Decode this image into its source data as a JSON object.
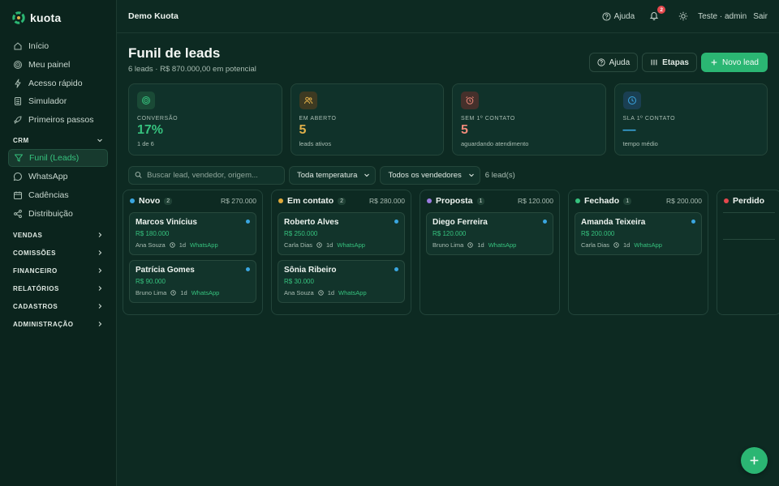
{
  "brand": {
    "name": "kuota"
  },
  "sidebar": {
    "top_items": [
      {
        "label": "Início",
        "icon": "home-icon"
      },
      {
        "label": "Meu painel",
        "icon": "target-icon"
      },
      {
        "label": "Acesso rápido",
        "icon": "bolt-icon"
      },
      {
        "label": "Simulador",
        "icon": "calculator-icon"
      },
      {
        "label": "Primeiros passos",
        "icon": "rocket-icon"
      }
    ],
    "crm_section": "CRM",
    "crm_items": [
      {
        "label": "Funil (Leads)",
        "icon": "funnel-icon",
        "active": true
      },
      {
        "label": "WhatsApp",
        "icon": "chat-icon"
      },
      {
        "label": "Cadências",
        "icon": "calendar-icon"
      },
      {
        "label": "Distribuição",
        "icon": "share-icon"
      }
    ],
    "sections": [
      "VENDAS",
      "COMISSÕES",
      "FINANCEIRO",
      "RELATÓRIOS",
      "CADASTROS",
      "ADMINISTRAÇÃO"
    ]
  },
  "topbar": {
    "company": "Demo Kuota",
    "help": "Ajuda",
    "notifications": "2",
    "user": "Teste · admin",
    "logout": "Sair"
  },
  "page": {
    "title": "Funil de leads",
    "subtitle": "6 leads · R$ 870.000,00 em potencial",
    "help_button": "Ajuda",
    "stages_button": "Etapas",
    "new_lead_button": "Novo lead"
  },
  "kpis": [
    {
      "label": "CONVERSÃO",
      "value": "17%",
      "note": "1 de 6",
      "color": "#36c27e",
      "icon": "target-icon"
    },
    {
      "label": "EM ABERTO",
      "value": "5",
      "note": "leads ativos",
      "color": "#e0b04a",
      "icon": "users-icon"
    },
    {
      "label": "SEM 1º CONTATO",
      "value": "5",
      "note": "aguardando atendimento",
      "color": "#f08a7a",
      "icon": "alarm-icon"
    },
    {
      "label": "SLA 1º CONTATO",
      "value": "—",
      "note": "tempo médio",
      "color": "#3aa6e0",
      "icon": "clock-icon"
    }
  ],
  "filters": {
    "search_placeholder": "Buscar lead, vendedor, origem...",
    "temperature": "Toda temperatura",
    "sellers": "Todos os vendedores",
    "count": "6 lead(s)"
  },
  "columns": [
    {
      "name": "Novo",
      "count": "2",
      "total": "R$ 270.000",
      "color": "#3aa6e0",
      "cards": [
        {
          "name": "Marcos Vinícius",
          "value": "R$ 180.000",
          "seller": "Ana Souza",
          "age": "1d",
          "channel": "WhatsApp"
        },
        {
          "name": "Patrícia Gomes",
          "value": "R$ 90.000",
          "seller": "Bruno Lima",
          "age": "1d",
          "channel": "WhatsApp"
        }
      ]
    },
    {
      "name": "Em contato",
      "count": "2",
      "total": "R$ 280.000",
      "color": "#e0a93a",
      "cards": [
        {
          "name": "Roberto Alves",
          "value": "R$ 250.000",
          "seller": "Carla Dias",
          "age": "1d",
          "channel": "WhatsApp"
        },
        {
          "name": "Sônia Ribeiro",
          "value": "R$ 30.000",
          "seller": "Ana Souza",
          "age": "1d",
          "channel": "WhatsApp"
        }
      ]
    },
    {
      "name": "Proposta",
      "count": "1",
      "total": "R$ 120.000",
      "color": "#9b7be0",
      "cards": [
        {
          "name": "Diego Ferreira",
          "value": "R$ 120.000",
          "seller": "Bruno Lima",
          "age": "1d",
          "channel": "WhatsApp"
        }
      ]
    },
    {
      "name": "Fechado",
      "count": "1",
      "total": "R$ 200.000",
      "color": "#36c27e",
      "cards": [
        {
          "name": "Amanda Teixeira",
          "value": "R$ 200.000",
          "seller": "Carla Dias",
          "age": "1d",
          "channel": "WhatsApp"
        }
      ]
    },
    {
      "name": "Perdido",
      "count": "",
      "total": "",
      "color": "#e5484d",
      "cards": []
    }
  ]
}
